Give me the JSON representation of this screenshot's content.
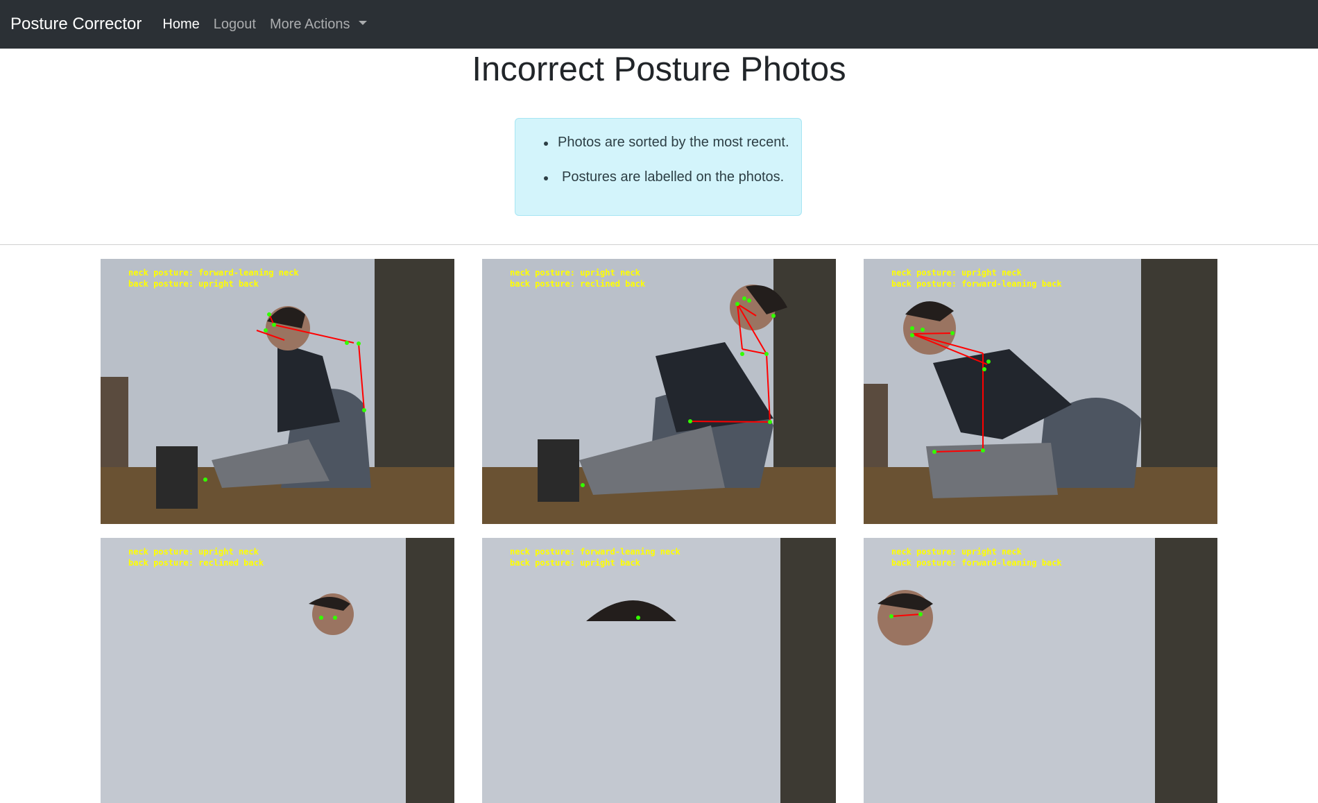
{
  "navbar": {
    "brand": "Posture Corrector",
    "links": [
      {
        "label": "Home",
        "active": true
      },
      {
        "label": "Logout",
        "active": false
      },
      {
        "label": "More Actions",
        "active": false
      }
    ]
  },
  "page": {
    "title": "Incorrect Posture Photos"
  },
  "info": {
    "items": [
      "Photos are sorted by the most recent.",
      "Postures are labelled on the photos."
    ],
    "colors": {
      "background": "#d3f4fb",
      "border": "#a6e5f3"
    }
  },
  "photos": [
    {
      "neck": "neck posture: forward-leaning neck",
      "back": "back posture: upright back"
    },
    {
      "neck": "neck posture: upright neck",
      "back": "back posture: reclined back"
    },
    {
      "neck": "neck posture: upright neck",
      "back": "back posture: forward-leaning back"
    },
    {
      "neck": "neck posture: upright neck",
      "back": "back posture: reclined back"
    },
    {
      "neck": "neck posture: forward-leaning neck",
      "back": "back posture: upright back"
    },
    {
      "neck": "neck posture: upright neck",
      "back": "back posture: forward-leaning back"
    }
  ],
  "colors": {
    "navbar": "#2b3035",
    "label_text": "#ffff00",
    "skeleton_line": "#ff0000",
    "skeleton_point": "#33ff00"
  }
}
